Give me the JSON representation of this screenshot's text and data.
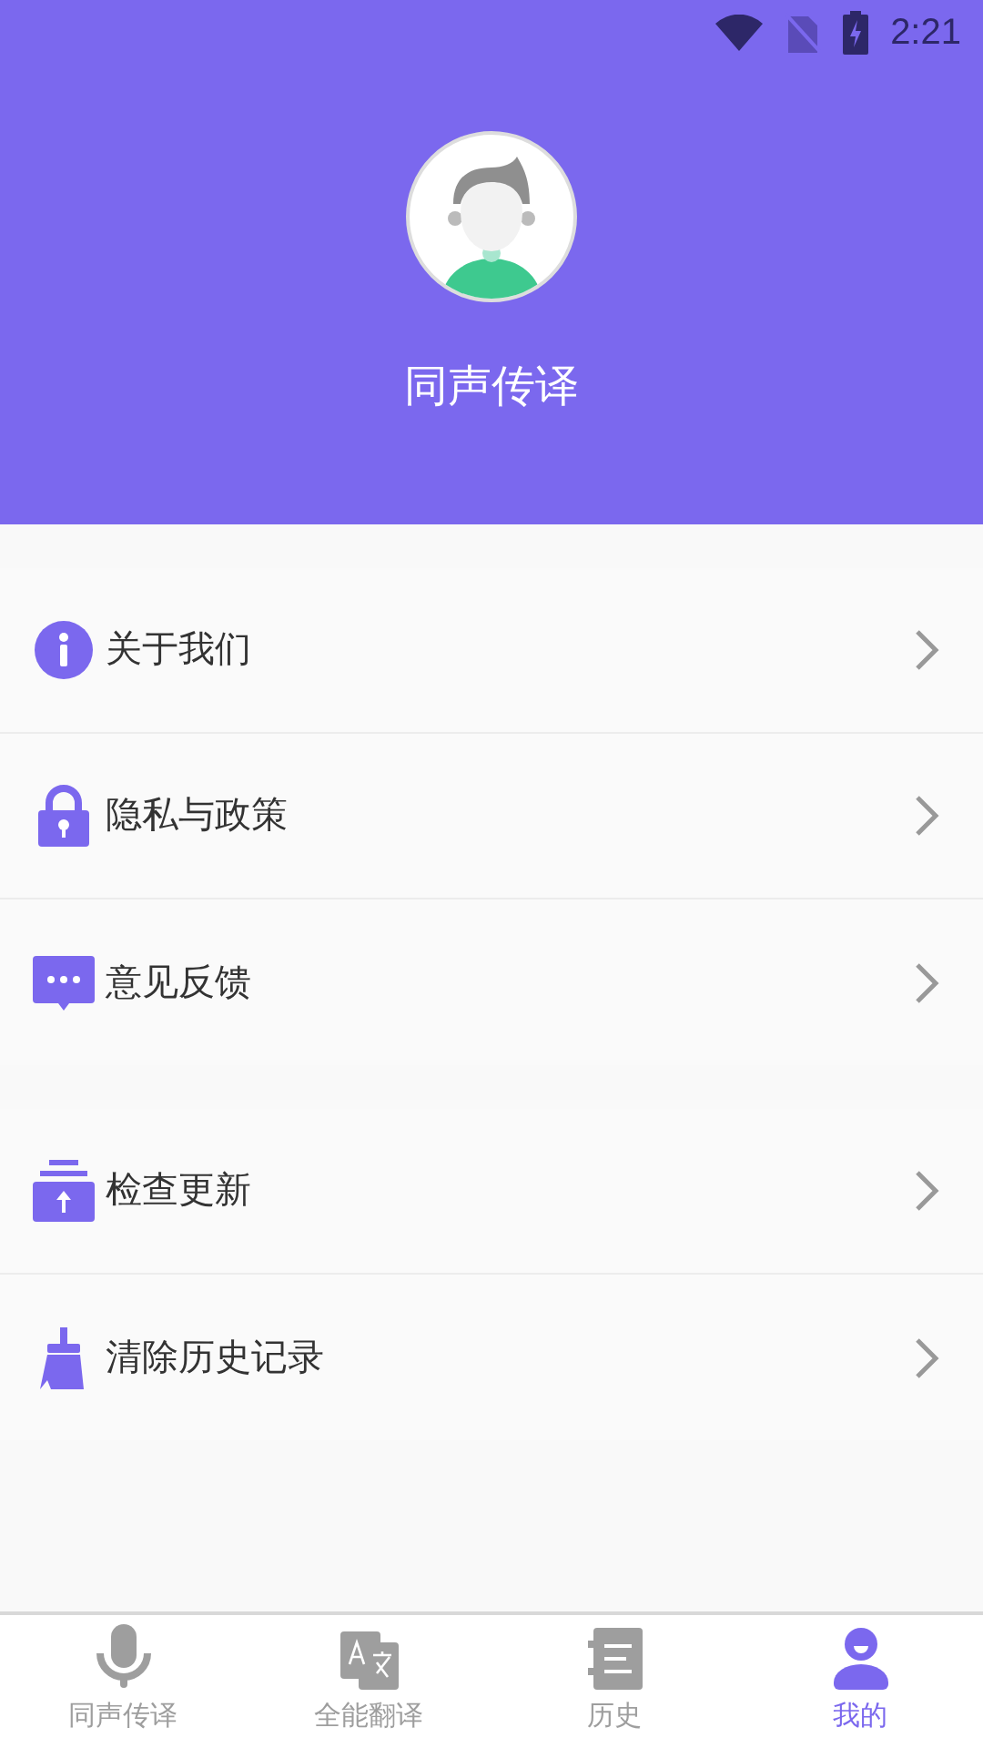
{
  "status_bar": {
    "time": "2:21"
  },
  "profile": {
    "name": "同声传译"
  },
  "menu_groups": [
    {
      "items": [
        {
          "kind": "info",
          "label": "关于我们"
        },
        {
          "kind": "lock",
          "label": "隐私与政策"
        },
        {
          "kind": "feedback",
          "label": "意见反馈"
        }
      ]
    },
    {
      "items": [
        {
          "kind": "update",
          "label": "检查更新"
        },
        {
          "kind": "clear",
          "label": "清除历史记录"
        }
      ]
    }
  ],
  "nav": [
    {
      "kind": "mic",
      "label": "同声传译",
      "selected": false
    },
    {
      "kind": "translate",
      "label": "全能翻译",
      "selected": false
    },
    {
      "kind": "history",
      "label": "历史",
      "selected": false
    },
    {
      "kind": "me",
      "label": "我的",
      "selected": true
    }
  ]
}
